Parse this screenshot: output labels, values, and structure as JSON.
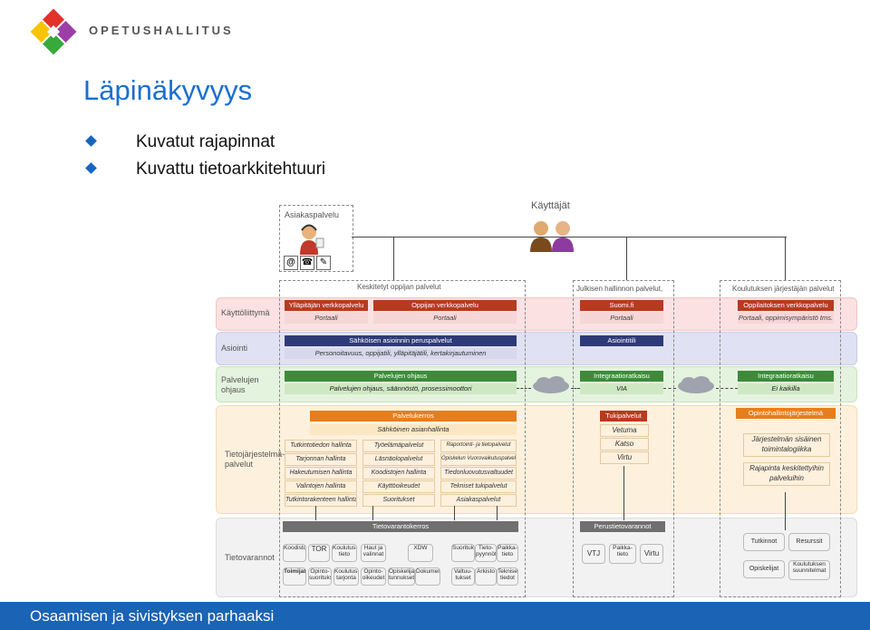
{
  "header": {
    "logo_text": "OPETUSHALLITUS",
    "title": "Läpinäkyvyys"
  },
  "bullets": [
    "Kuvatut rajapinnat",
    "Kuvattu tietoarkkitehtuuri"
  ],
  "footer": {
    "text": "Osaamisen ja sivistyksen parhaaksi"
  },
  "diagram": {
    "top": {
      "asiakaspalvelu": "Asiakaspalvelu",
      "kayttajat": "Käyttäjät",
      "at_symbol": "@"
    },
    "columns": {
      "keskitetyt": "Keskitetyt oppijan palvelut",
      "julkisen": "Julkisen hallinnon palvelut,",
      "koulutuksen": "Koulutuksen järjestäjän palvelut"
    },
    "rows": {
      "kayttoliittyma": "Käyttöliittymä",
      "asiointi": "Asiointi",
      "palvelujen_ohjaus": "Palvelujen ohjaus",
      "tietojarjestelmapalvelut": "Tietojärjestelmä-palvelut",
      "tietovarannot": "Tietovarannot"
    },
    "ui": {
      "yllapitajan": "Ylläpitäjän verkkopalvelu",
      "oppijan": "Oppijan verkkopalvelu",
      "portaali1": "Portaali",
      "portaali2": "Portaali",
      "suomifi": "Suomi.fi",
      "portaali3": "Portaali",
      "oppilaitoksen": "Oppilaitoksen verkkopalvelu",
      "portaali4": "Portaali, oppimisympäristö tms."
    },
    "asiointi": {
      "sahkoisen": "Sähköisen asioinnin peruspalvelut",
      "personointi": "Personoitavuus, oppijatili, ylläpitäjätili, kertakirjautuminen",
      "asiointitili": "Asiointitili"
    },
    "ohjaus": {
      "palvelujen_ohjaus": "Palvelujen ohjaus",
      "palvelujen_ohjaus_detail": "Palvelujen ohjaus, säännöstö, prosessimoottori",
      "integraatio1": "Integraatioratkaisu",
      "via": "VIA",
      "integraatio2": "Integraatioratkaisu",
      "ei_kaikilla": "Ei kaikilla"
    },
    "tj": {
      "palvelukerros": "Palvelukerros",
      "asianhallinta": "Sähköinen asianhallinta",
      "grid": [
        [
          "Tutkintotiedon hallinta",
          "Työelämäpalvelut",
          "Raportointi- ja tietopalvelut"
        ],
        [
          "Tarjonnan hallinta",
          "Läsnäolopalvelut",
          "Opiskelun Vuorovaikutuspalvelut"
        ],
        [
          "Hakeutumisen hallinta",
          "Koodistojen hallinta",
          "Tiedonluovutusvaltuudet"
        ],
        [
          "Valintojen hallinta",
          "Käyttöoikeudet",
          "Tekniset tukipalvelut"
        ],
        [
          "Tutkintorakenteen hallinta",
          "Suoritukset",
          "Asiakaspalvelut"
        ]
      ],
      "tukipalvelut": "Tukipalvelut",
      "tuki_items": [
        "Vetuma",
        "Katso",
        "Virtu"
      ],
      "opintohallinto": "Opintohallintojärjestelmä",
      "opinto_items": [
        "Järjestelmän sisäinen toimintalogiikka",
        "Rajapinta keskitettyihin palveluihin"
      ]
    },
    "tv": {
      "tietovarantokerros": "Tietovarantokerros",
      "perustietovarannot": "Perustietovarannot",
      "db_left": [
        "Koodistot",
        "TOR",
        "Koulutus-tieto",
        "Haut ja valinnat",
        "XDW",
        "Suoritukset",
        "Tieto-pyynnöt",
        "Paikka-tieto",
        "Toimijat",
        "Opinto-suoritukset",
        "Koulutus-tarjonta",
        "Opinto-oikeudet",
        "Opiskelijan tunnukset",
        "Dokumentit",
        "Valtuu-tukset",
        "Arkisto",
        "Tekniset tiedot"
      ],
      "db_mid": [
        "VTJ",
        "Paikka-tieto",
        "Virtu"
      ],
      "db_right": [
        "Tutkinnot",
        "Resurssit",
        "Opiskelijat",
        "Koulutuksen suunnitelmat"
      ]
    }
  }
}
